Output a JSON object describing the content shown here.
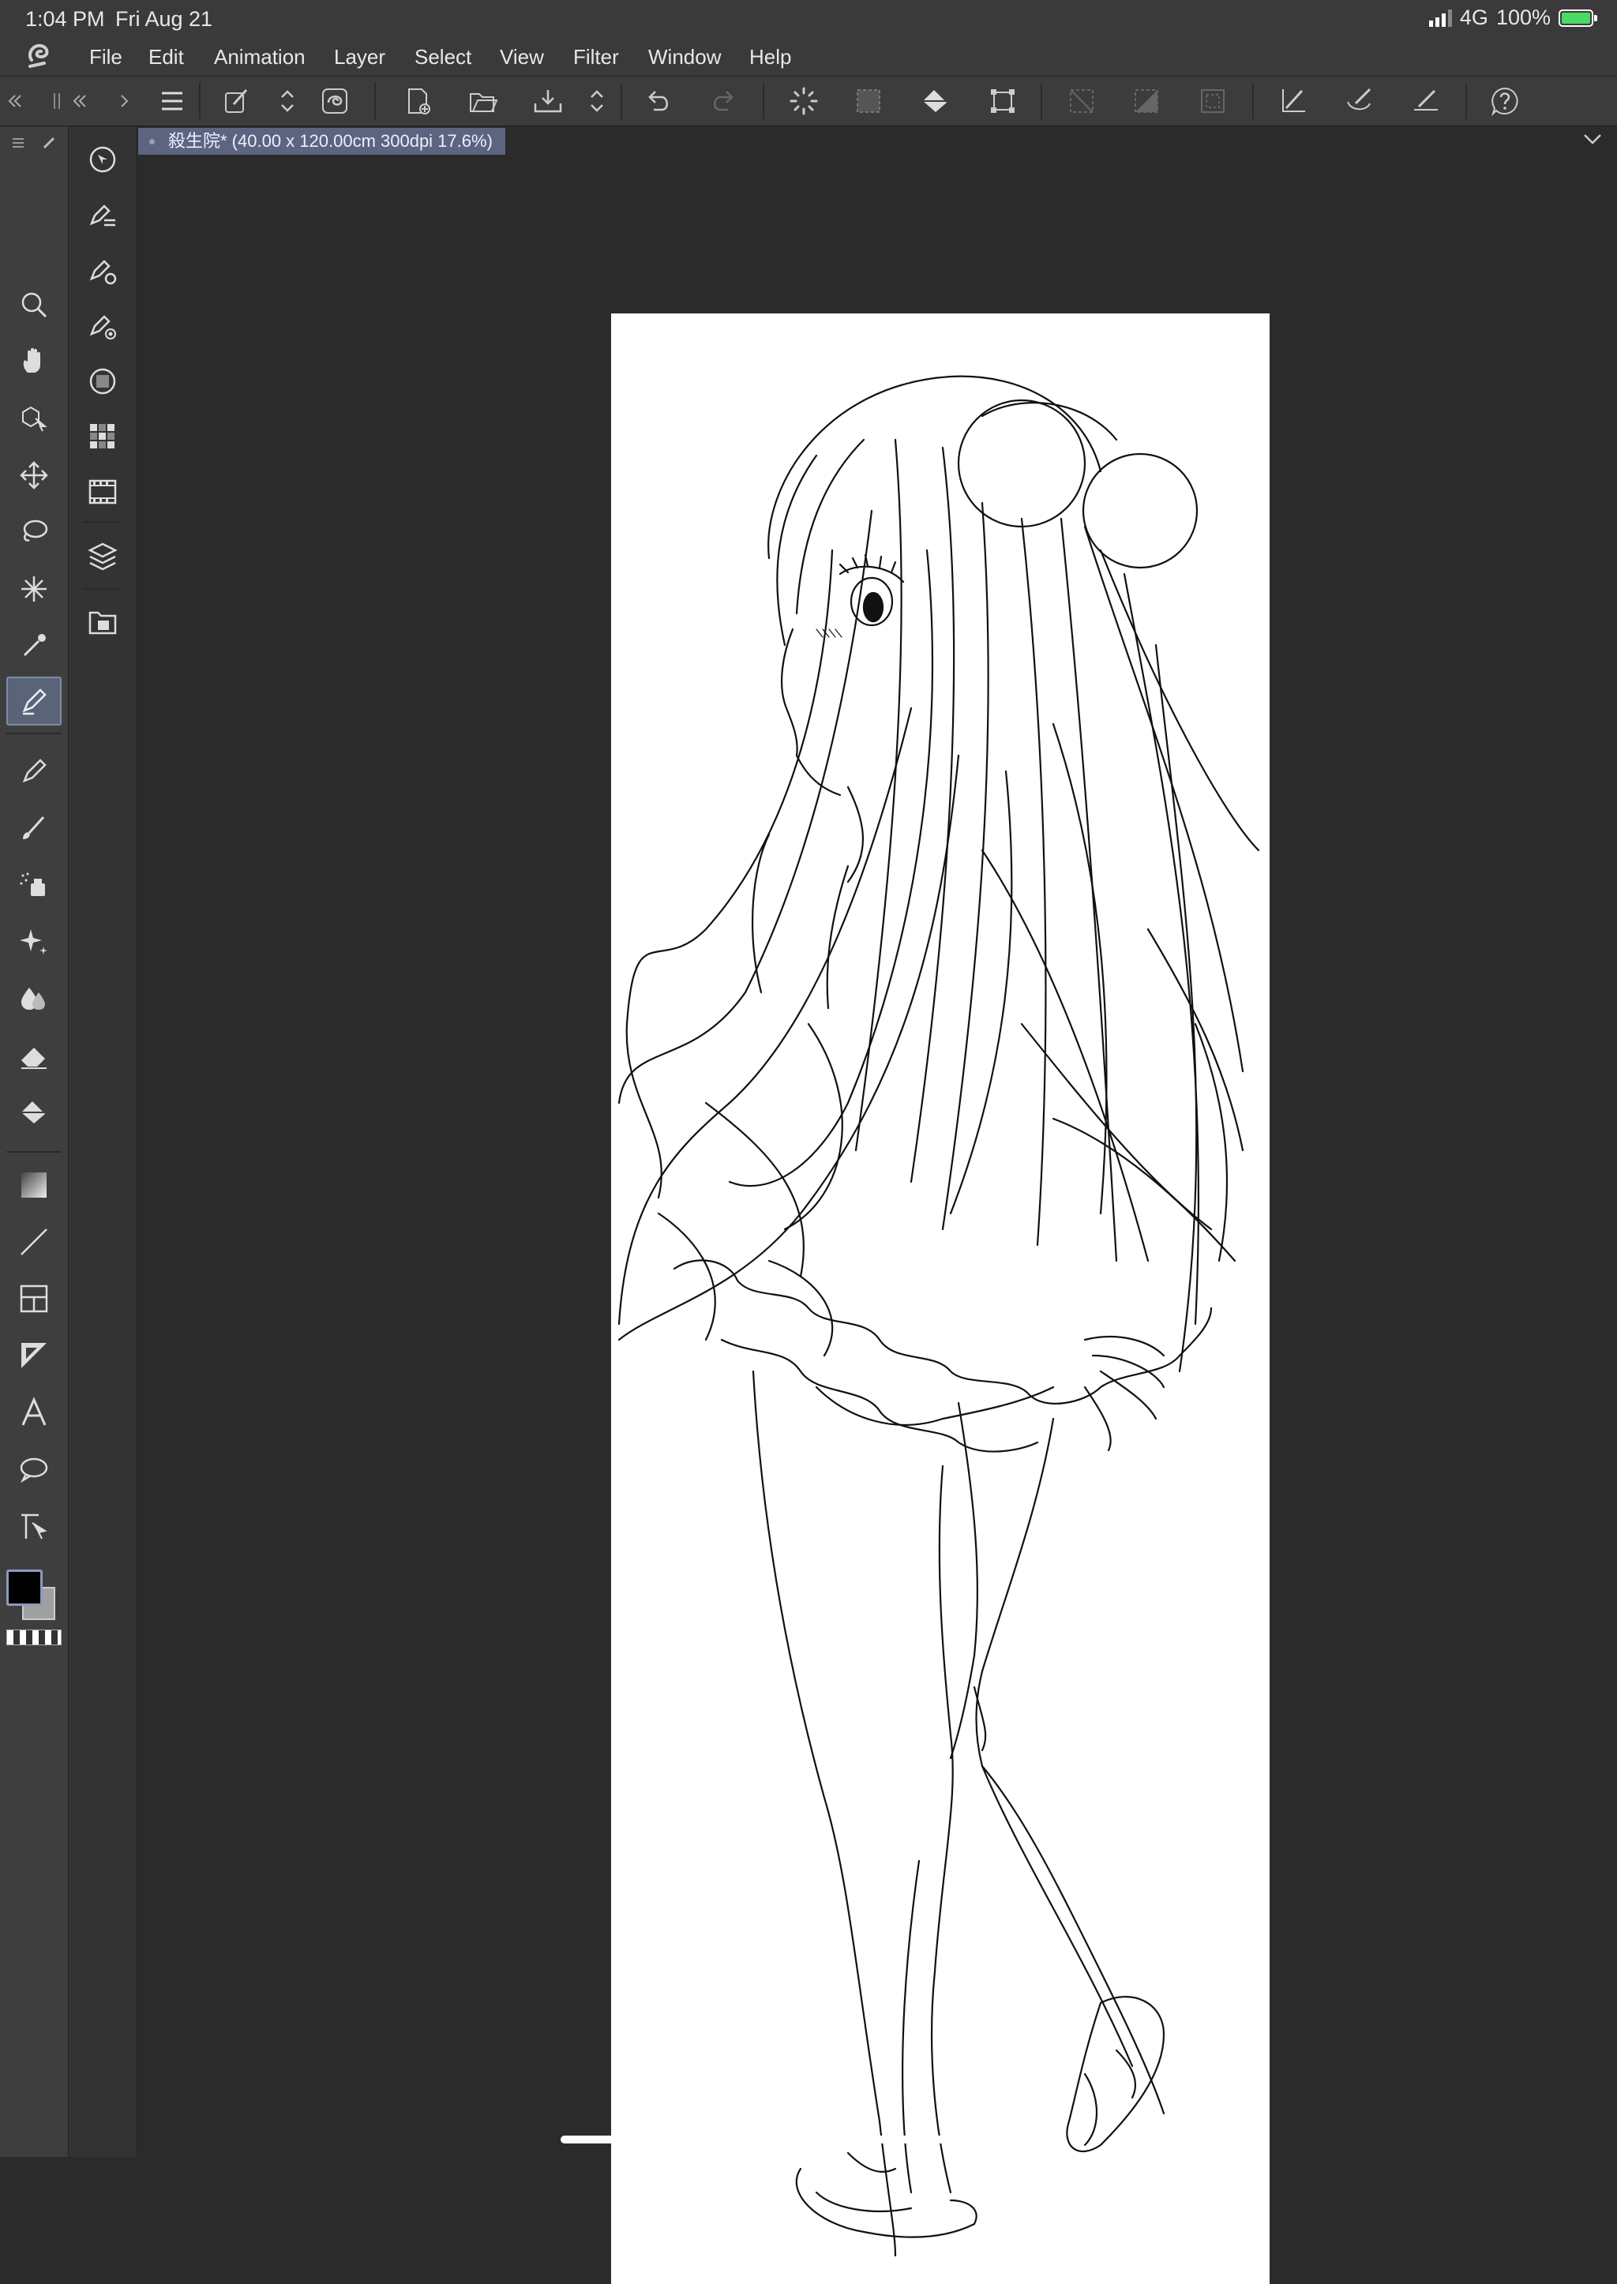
{
  "status": {
    "time": "1:04 PM",
    "date": "Fri Aug 21",
    "network": "4G",
    "battery": "100%"
  },
  "menu": [
    "File",
    "Edit",
    "Animation",
    "Layer",
    "Select",
    "View",
    "Filter",
    "Window",
    "Help"
  ],
  "document": {
    "tab_title": "殺生院* (40.00 x 120.00cm 300dpi 17.6%)"
  },
  "colors": {
    "main": "#000000",
    "sub": "#a0a0a0",
    "active_tool_bg": "#5a6478",
    "tab_bg": "#5b6580"
  },
  "toolbar_icons": [
    "menu-icon",
    "brush-settings-icon",
    "up-down-icon",
    "layer-swirl-icon",
    "new-canvas-icon",
    "open-folder-icon",
    "save-icon",
    "up-down-icon",
    "undo-icon",
    "redo-icon",
    "loading-icon",
    "selection-icon",
    "fill-icon",
    "transform-icon",
    "deselect-icon",
    "invert-selection-icon",
    "border-selection-icon",
    "pen-pressure-icon",
    "brush-shape-icon",
    "ruler-icon",
    "help-icon"
  ],
  "tools": [
    "zoom-icon",
    "hand-icon",
    "object-icon",
    "move-icon",
    "lasso-icon",
    "magic-wand-icon",
    "eyedropper-icon",
    "pen-icon",
    "pencil-icon",
    "brush-icon",
    "airbrush-icon",
    "decoration-icon",
    "blend-icon",
    "eraser-icon",
    "fill-bucket-icon",
    "gradient-icon",
    "line-icon",
    "frame-icon",
    "ruler-tool-icon",
    "text-icon",
    "balloon-icon",
    "correct-line-icon"
  ]
}
